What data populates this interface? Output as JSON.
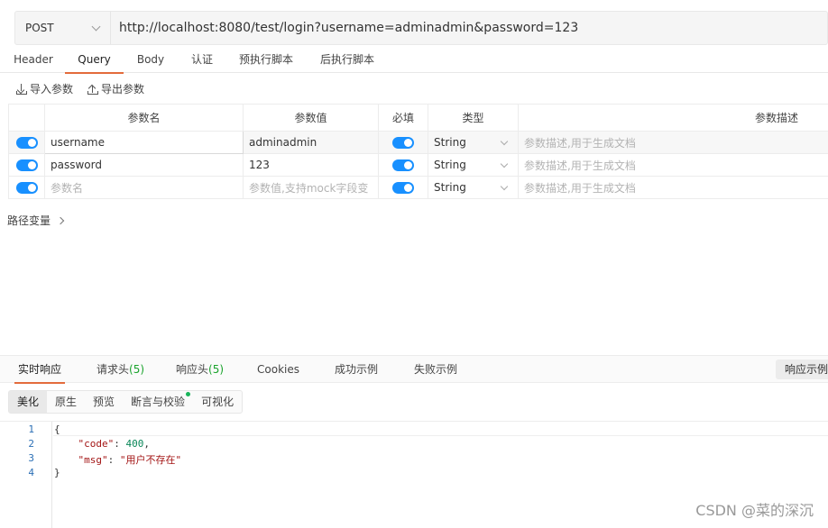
{
  "request": {
    "method": "POST",
    "url": "http://localhost:8080/test/login?username=adminadmin&password=123"
  },
  "req_tabs": [
    "Header",
    "Query",
    "Body",
    "认证",
    "预执行脚本",
    "后执行脚本"
  ],
  "active_req_tab": "Query",
  "tools": {
    "import": "导入参数",
    "export": "导出参数"
  },
  "params": {
    "headers": [
      "参数名",
      "参数值",
      "必填",
      "类型",
      "参数描述"
    ],
    "rows": [
      {
        "name": "username",
        "value": "adminadmin",
        "type": "String",
        "desc_placeholder": "参数描述,用于生成文档"
      },
      {
        "name": "password",
        "value": "123",
        "type": "String",
        "desc_placeholder": "参数描述,用于生成文档"
      },
      {
        "name_placeholder": "参数名",
        "value_placeholder": "参数值,支持mock字段变",
        "type": "String",
        "desc_placeholder": "参数描述,用于生成文档"
      }
    ]
  },
  "path_vars": "路径变量",
  "resp_tabs": {
    "realtime": "实时响应",
    "req_headers": "请求头",
    "req_headers_count": "(5)",
    "resp_headers": "响应头",
    "resp_headers_count": "(5)",
    "cookies": "Cookies",
    "success_example": "成功示例",
    "fail_example": "失败示例",
    "resp_example_btn": "响应示例"
  },
  "view_tabs": [
    "美化",
    "原生",
    "预览",
    "断言与校验",
    "可视化"
  ],
  "code": {
    "line_numbers": [
      "1",
      "2",
      "3",
      "4"
    ],
    "open": "{",
    "code_key": "\"code\"",
    "code_val": "400",
    "msg_key": "\"msg\"",
    "msg_val": "\"用户不存在\"",
    "close": "}"
  },
  "watermark": "CSDN @菜的深沉",
  "colors": {
    "accent": "#e36b3c",
    "toggle": "#1890ff",
    "count": "#1aa32c"
  }
}
